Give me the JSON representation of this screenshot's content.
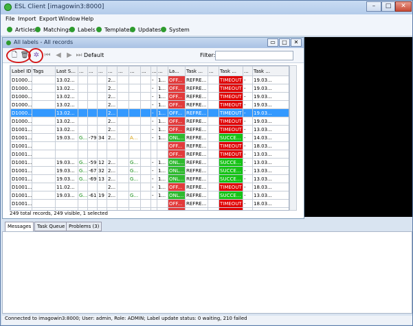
{
  "app": {
    "title": "ESL Client [imagowin3:8000]"
  },
  "window_controls": [
    "–",
    "□",
    "✕"
  ],
  "menu": [
    "File",
    "Import",
    "Export",
    "Window",
    "Help"
  ],
  "nav": [
    "Articles",
    "Matchings",
    "Labels",
    "Templates",
    "Updates",
    "System"
  ],
  "panel": {
    "title": "All labels - All records",
    "controls": [
      "▭",
      "□",
      "✕"
    ]
  },
  "toolbar": {
    "default_label": "Default",
    "filter_label": "Filter:",
    "filter_value": ""
  },
  "grid": {
    "columns": [
      "Label ID",
      "Tags",
      "Last S...",
      "...",
      "...",
      "...",
      "...",
      "...",
      "...",
      "...",
      "...",
      "...",
      "La...",
      "Task ...",
      "...",
      "Task ...",
      "...",
      "Task ..."
    ],
    "rows": [
      [
        "D1000...",
        "",
        "13.02...",
        "",
        "",
        "",
        "2...",
        "",
        "",
        "",
        "-",
        "1...",
        "OFF...",
        "REFRE...",
        "",
        "TIMEOUT",
        "-",
        "19.03..."
      ],
      [
        "D1000...",
        "",
        "13.02...",
        "",
        "",
        "",
        "2...",
        "",
        "",
        "",
        "-",
        "1...",
        "OFF...",
        "REFRE...",
        "",
        "TIMEOUT",
        "-",
        "19.03..."
      ],
      [
        "D1000...",
        "",
        "13.02...",
        "",
        "",
        "",
        "2...",
        "",
        "",
        "",
        "-",
        "1...",
        "OFF...",
        "REFRE...",
        "",
        "TIMEOUT",
        "-",
        "19.03..."
      ],
      [
        "D1000...",
        "",
        "13.02...",
        "",
        "",
        "",
        "2...",
        "",
        "",
        "",
        "-",
        "1...",
        "OFF...",
        "REFRE...",
        "",
        "TIMEOUT",
        "-",
        "19.03..."
      ],
      [
        "D1000...",
        "",
        "13.02...",
        "",
        "",
        "",
        "2...",
        "",
        "",
        "",
        "-",
        "1...",
        "OFF...",
        "REFRE...",
        "",
        "TIMEOUT",
        "-",
        "19.03..."
      ],
      [
        "D1000...",
        "",
        "13.02...",
        "",
        "",
        "",
        "2...",
        "",
        "",
        "",
        "-",
        "1...",
        "OFF...",
        "REFRE...",
        "",
        "TIMEOUT",
        "-",
        "19.03..."
      ],
      [
        "D1001...",
        "",
        "13.02...",
        "",
        "",
        "",
        "2...",
        "",
        "",
        "",
        "-",
        "1...",
        "OFF...",
        "REFRE...",
        "",
        "TIMEOUT",
        "-",
        "13.03..."
      ],
      [
        "D1001...",
        "",
        "19.03...",
        "G...",
        "-79",
        "34",
        "2...",
        "",
        "A...",
        "",
        "-",
        "1...",
        "ONL...",
        "REFRE...",
        "",
        "SUCCE...",
        "-",
        "14.03..."
      ],
      [
        "D1001...",
        "",
        "",
        "",
        "",
        "",
        "",
        "",
        "",
        "",
        "",
        "",
        "OFF...",
        "REFRE...",
        "",
        "TIMEOUT",
        "-",
        "18.03..."
      ],
      [
        "D1001...",
        "",
        "",
        "",
        "",
        "",
        "",
        "",
        "",
        "",
        "",
        "",
        "OFF...",
        "REFRE...",
        "",
        "TIMEOUT",
        "-",
        "13.03..."
      ],
      [
        "D1001...",
        "",
        "19.03...",
        "G...",
        "-59",
        "12",
        "2...",
        "",
        "G...",
        "",
        "-",
        "1...",
        "ONL...",
        "REFRE...",
        "",
        "SUCCE...",
        "-",
        "13.03..."
      ],
      [
        "D1001...",
        "",
        "19.03...",
        "G...",
        "-67",
        "32",
        "2...",
        "",
        "G...",
        "",
        "-",
        "1...",
        "ONL...",
        "REFRE...",
        "",
        "SUCCE...",
        "-",
        "13.03..."
      ],
      [
        "D1001...",
        "",
        "19.03...",
        "G...",
        "-69",
        "13",
        "2...",
        "",
        "G...",
        "",
        "-",
        "1...",
        "ONL...",
        "REFRE...",
        "",
        "SUCCE...",
        "-",
        "13.03..."
      ],
      [
        "D1001...",
        "",
        "11.02...",
        "",
        "",
        "",
        "2...",
        "",
        "",
        "",
        "-",
        "1...",
        "OFF...",
        "REFRE...",
        "",
        "TIMEOUT",
        "-",
        "18.03..."
      ],
      [
        "D1001...",
        "",
        "19.03...",
        "G...",
        "-61",
        "19",
        "2...",
        "",
        "G...",
        "",
        "-",
        "1...",
        "ONL...",
        "REFRE...",
        "",
        "SUCCE...",
        "-",
        "13.03..."
      ],
      [
        "D1001...",
        "",
        "",
        "",
        "",
        "",
        "",
        "",
        "",
        "",
        "",
        "",
        "OFF...",
        "REFRE...",
        "",
        "TIMEOUT",
        "-",
        "18.03..."
      ],
      [
        "D1001...",
        "",
        "",
        "",
        "",
        "",
        "",
        "",
        "",
        "",
        "",
        "",
        "OFF...",
        "REFRE...",
        "",
        "TIMEOUT",
        "-",
        "18.03..."
      ]
    ]
  },
  "records_status": "249 total records, 249 visible, 1 selected",
  "bottom_tabs": [
    "Messages",
    "Task Queue",
    "Problems (3)"
  ],
  "statusbar": "Connected to imagowin3:8000; User: admin, Role: ADMIN; Label update status: 0 waiting, 210 failed"
}
